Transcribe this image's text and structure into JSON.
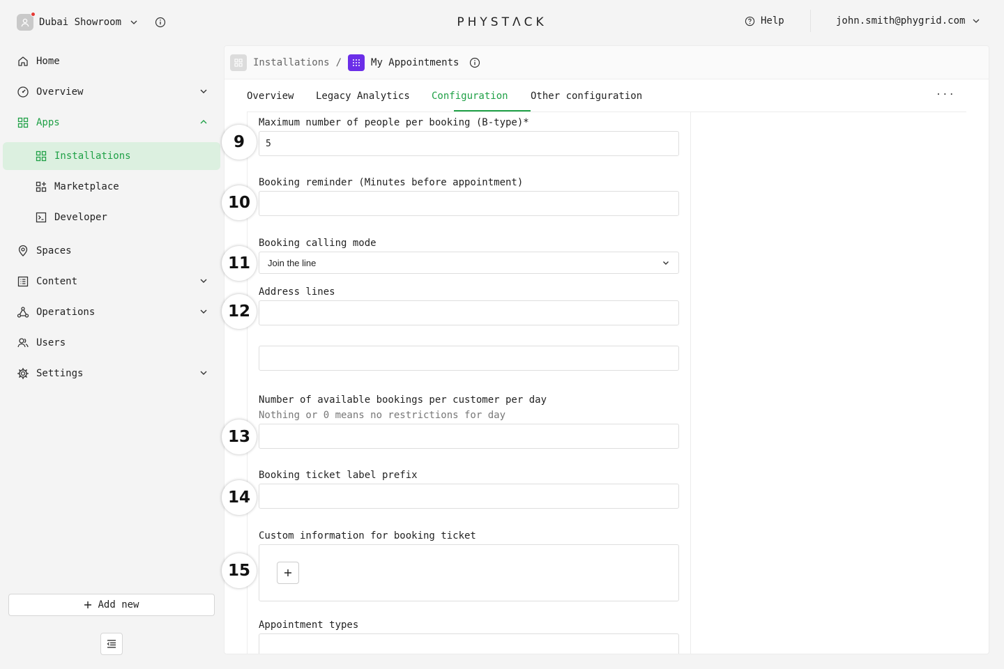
{
  "topbar": {
    "workspace": "Dubai Showroom",
    "logo": "PHYSTΛCK",
    "help": "Help",
    "user_email": "john.smith@phygrid.com"
  },
  "sidebar": {
    "items": [
      {
        "label": "Home",
        "icon": "home-icon"
      },
      {
        "label": "Overview",
        "icon": "gauge-icon"
      },
      {
        "label": "Apps",
        "icon": "apps-grid-icon"
      },
      {
        "label": "Installations",
        "icon": "apps-grid-icon"
      },
      {
        "label": "Marketplace",
        "icon": "marketplace-icon"
      },
      {
        "label": "Developer",
        "icon": "terminal-icon"
      },
      {
        "label": "Spaces",
        "icon": "location-pin-icon"
      },
      {
        "label": "Content",
        "icon": "content-list-icon"
      },
      {
        "label": "Operations",
        "icon": "network-icon"
      },
      {
        "label": "Users",
        "icon": "users-icon"
      },
      {
        "label": "Settings",
        "icon": "gear-icon"
      }
    ],
    "add_new": "Add new",
    "accent_color": "#1fa046"
  },
  "breadcrumb": {
    "parent": "Installations",
    "separator": "/",
    "current": "My Appointments"
  },
  "tabs": [
    "Overview",
    "Legacy Analytics",
    "Configuration",
    "Other configuration"
  ],
  "active_tab": "Configuration",
  "form": {
    "max_people_label": "Maximum number of people per booking (B-type)*",
    "max_people_value": "5",
    "reminder_label": "Booking reminder (Minutes before appointment)",
    "reminder_value": "",
    "calling_mode_label": "Booking calling mode",
    "calling_mode_value": "Join the line",
    "address_label": "Address lines",
    "address_line_1": "",
    "address_line_2": "",
    "bookings_per_day_label": "Number of available bookings per customer per day",
    "bookings_per_day_hint": "Nothing or 0 means no restrictions for day",
    "bookings_per_day_value": "",
    "ticket_prefix_label": "Booking ticket label prefix",
    "ticket_prefix_value": "",
    "custom_info_label": "Custom information for booking ticket",
    "appointment_types_label": "Appointment types"
  },
  "steps": [
    "9",
    "10",
    "11",
    "12",
    "13",
    "14",
    "15"
  ]
}
